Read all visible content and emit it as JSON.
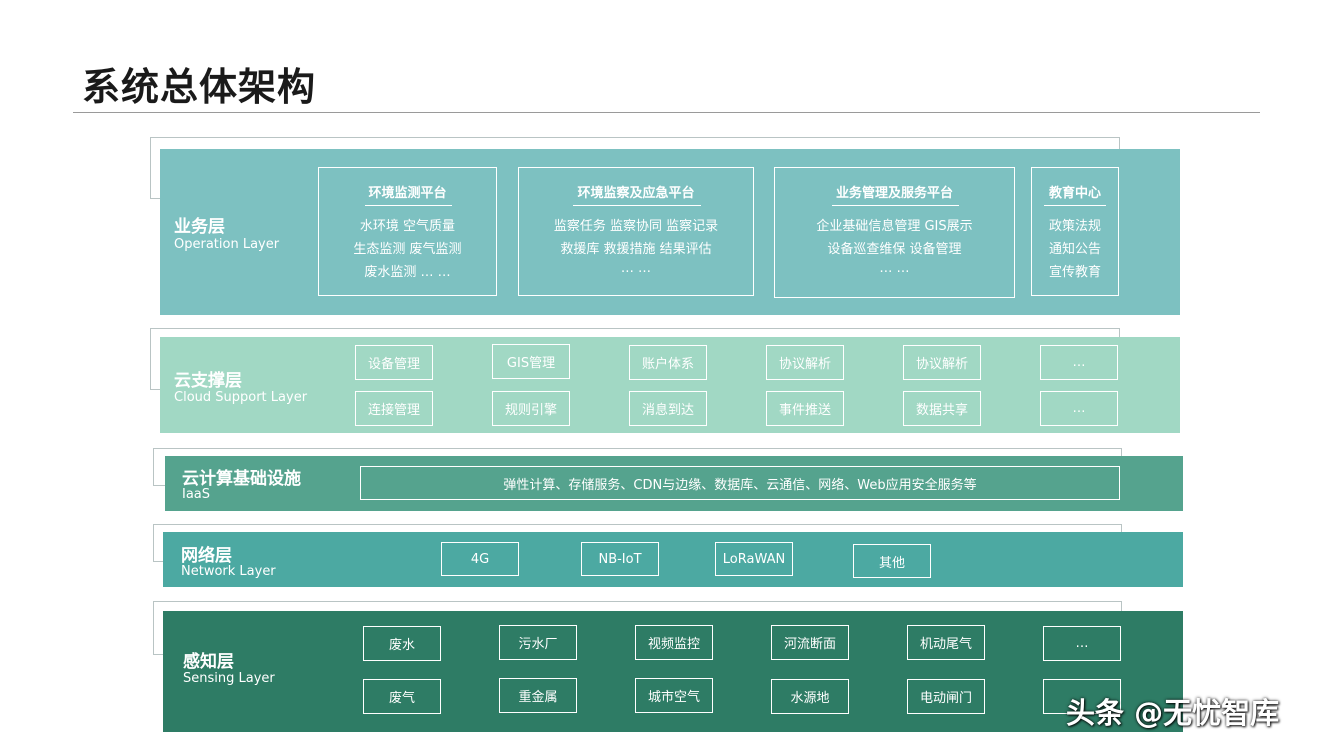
{
  "title": "系统总体架构",
  "colors": {
    "operation": "#7dc1c1",
    "cloud_support": "#a1d8c4",
    "iaas": "#55a38e",
    "network": "#4ca9a2",
    "sensing": "#2e7c65"
  },
  "operation_layer": {
    "name": "业务层",
    "sub": "Operation Layer",
    "platforms": [
      {
        "title": "环境监测平台",
        "lines": [
          "水环境    空气质量",
          "生态监测  废气监测",
          "废水监测    … …"
        ]
      },
      {
        "title": "环境监察及应急平台",
        "lines": [
          "监察任务  监察协同  监察记录",
          "救援库    救援措施  结果评估",
          "… …"
        ]
      },
      {
        "title": "业务管理及服务平台",
        "lines": [
          "企业基础信息管理      GIS展示",
          "设备巡查维保          设备管理",
          "… …"
        ]
      },
      {
        "title": "教育中心",
        "lines": [
          "政策法规",
          "通知公告",
          "宣传教育"
        ]
      }
    ]
  },
  "cloud_support_layer": {
    "name": "云支撑层",
    "sub": "Cloud Support Layer",
    "row1": [
      "设备管理",
      "GIS管理",
      "账户体系",
      "协议解析",
      "协议解析",
      "…"
    ],
    "row2": [
      "连接管理",
      "规则引擎",
      "消息到达",
      "事件推送",
      "数据共享",
      "…"
    ]
  },
  "iaas_layer": {
    "name": "云计算基础设施",
    "sub": "IaaS",
    "content": "弹性计算、存储服务、CDN与边缘、数据库、云通信、网络、Web应用安全服务等"
  },
  "network_layer": {
    "name": "网络层",
    "sub": "Network Layer",
    "items": [
      "4G",
      "NB-IoT",
      "LoRaWAN",
      "其他"
    ]
  },
  "sensing_layer": {
    "name": "感知层",
    "sub": "Sensing Layer",
    "row1": [
      "废水",
      "污水厂",
      "视频监控",
      "河流断面",
      "机动尾气",
      "…"
    ],
    "row2": [
      "废气",
      "重金属",
      "城市空气",
      "水源地",
      "电动闸门",
      ""
    ]
  },
  "watermark": "头条 @无忧智库"
}
